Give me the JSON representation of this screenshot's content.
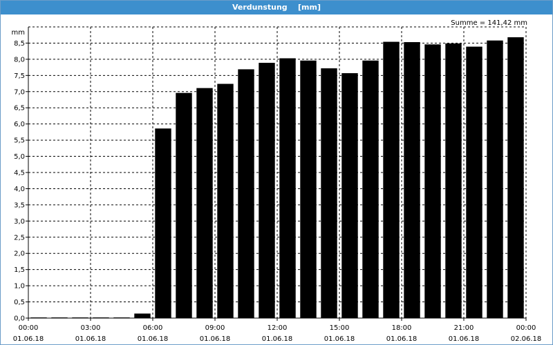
{
  "window": {
    "title": "Verdunstung",
    "unit": "[mm]"
  },
  "summary": "Summe = 141,42 mm",
  "chart_data": {
    "type": "bar",
    "title": "Verdunstung",
    "ylabel": "mm",
    "xlabel": "",
    "ylim": [
      0,
      9
    ],
    "grid": true,
    "color": "#000000",
    "y_ticks": [
      "0,0",
      "0,5",
      "1,0",
      "1,5",
      "2,0",
      "2,5",
      "3,0",
      "3,5",
      "4,0",
      "4,5",
      "5,0",
      "5,5",
      "6,0",
      "6,5",
      "7,0",
      "7,5",
      "8,0",
      "8,5"
    ],
    "x_ticks": [
      {
        "time": "00:00",
        "date": "01.06.18"
      },
      {
        "time": "03:00",
        "date": "01.06.18"
      },
      {
        "time": "06:00",
        "date": "01.06.18"
      },
      {
        "time": "09:00",
        "date": "01.06.18"
      },
      {
        "time": "12:00",
        "date": "01.06.18"
      },
      {
        "time": "15:00",
        "date": "01.06.18"
      },
      {
        "time": "18:00",
        "date": "01.06.18"
      },
      {
        "time": "21:00",
        "date": "01.06.18"
      },
      {
        "time": "00:00",
        "date": "02.06.18"
      }
    ],
    "categories": [
      "00:00",
      "01:00",
      "02:00",
      "03:00",
      "04:00",
      "05:00",
      "06:00",
      "07:00",
      "08:00",
      "09:00",
      "10:00",
      "11:00",
      "12:00",
      "13:00",
      "14:00",
      "15:00",
      "16:00",
      "17:00",
      "18:00",
      "19:00",
      "20:00",
      "21:00",
      "22:00",
      "23:00"
    ],
    "values": [
      0.02,
      0.02,
      0.02,
      0.02,
      0.02,
      0.14,
      5.86,
      6.96,
      7.11,
      7.24,
      7.69,
      7.89,
      8.03,
      7.96,
      7.72,
      7.57,
      7.96,
      8.54,
      8.53,
      8.46,
      8.49,
      8.39,
      8.58,
      8.68
    ]
  }
}
